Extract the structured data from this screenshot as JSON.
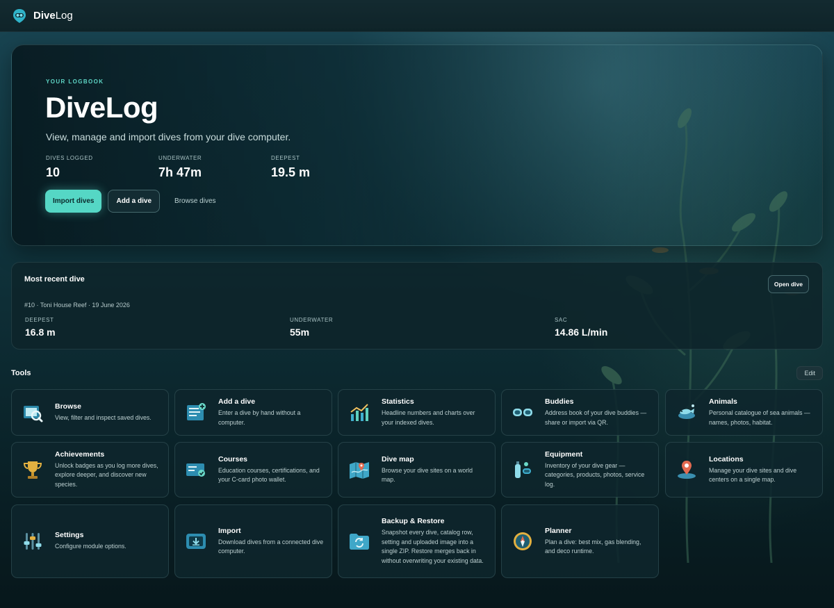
{
  "app": {
    "brand_bold": "Dive",
    "brand_light": "Log"
  },
  "hero": {
    "eyebrow": "YOUR LOGBOOK",
    "title": "DiveLog",
    "subtitle": "View, manage and import dives from your dive computer.",
    "stats": [
      {
        "label": "DIVES LOGGED",
        "value": "10"
      },
      {
        "label": "UNDERWATER",
        "value": "7h 47m"
      },
      {
        "label": "DEEPEST",
        "value": "19.5 m"
      }
    ],
    "buttons": {
      "import": "Import dives",
      "add": "Add a dive",
      "browse": "Browse dives"
    }
  },
  "recent": {
    "title": "Most recent dive",
    "meta": "#10 · Toni House Reef · 19 June 2026",
    "open_label": "Open dive",
    "stats": [
      {
        "label": "DEEPEST",
        "value": "16.8 m"
      },
      {
        "label": "UNDERWATER",
        "value": "55m"
      },
      {
        "label": "SAC",
        "value": "14.86 L/min"
      }
    ]
  },
  "tools": {
    "title": "Tools",
    "edit_label": "Edit",
    "items": [
      {
        "title": "Browse",
        "desc": "View, filter and inspect saved dives.",
        "icon": "browse-icon"
      },
      {
        "title": "Add a dive",
        "desc": "Enter a dive by hand without a computer.",
        "icon": "add-dive-icon"
      },
      {
        "title": "Statistics",
        "desc": "Headline numbers and charts over your indexed dives.",
        "icon": "statistics-icon"
      },
      {
        "title": "Buddies",
        "desc": "Address book of your dive buddies — share or import via QR.",
        "icon": "buddies-icon"
      },
      {
        "title": "Animals",
        "desc": "Personal catalogue of sea animals — names, photos, habitat.",
        "icon": "animals-icon"
      },
      {
        "title": "Achievements",
        "desc": "Unlock badges as you log more dives, explore deeper, and discover new species.",
        "icon": "trophy-icon"
      },
      {
        "title": "Courses",
        "desc": "Education courses, certifications, and your C-card photo wallet.",
        "icon": "courses-icon"
      },
      {
        "title": "Dive map",
        "desc": "Browse your dive sites on a world map.",
        "icon": "map-icon"
      },
      {
        "title": "Equipment",
        "desc": "Inventory of your dive gear — categories, products, photos, service log.",
        "icon": "equipment-icon"
      },
      {
        "title": "Locations",
        "desc": "Manage your dive sites and dive centers on a single map.",
        "icon": "location-pin-icon"
      },
      {
        "title": "Settings",
        "desc": "Configure module options.",
        "icon": "settings-icon"
      },
      {
        "title": "Import",
        "desc": "Download dives from a connected dive computer.",
        "icon": "import-icon"
      },
      {
        "title": "Backup & Restore",
        "desc": "Snapshot every dive, catalog row, setting and uploaded image into a single ZIP. Restore merges back in without overwriting your existing data.",
        "icon": "backup-icon"
      },
      {
        "title": "Planner",
        "desc": "Plan a dive: best mix, gas blending, and deco runtime.",
        "icon": "compass-icon"
      }
    ]
  },
  "colors": {
    "accent": "#55d7c5",
    "background": "#08181c",
    "card": "#0e262c"
  }
}
